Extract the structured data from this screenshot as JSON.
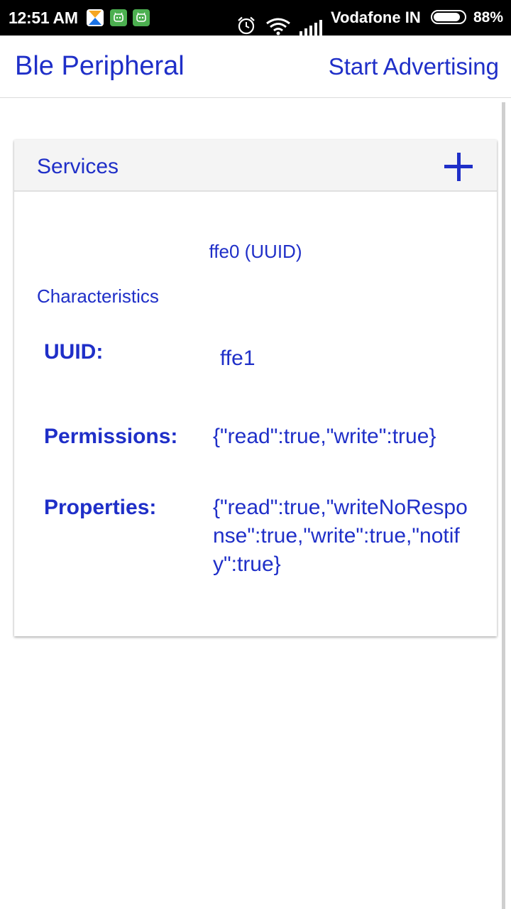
{
  "status_bar": {
    "time": "12:51 AM",
    "carrier": "Vodafone IN",
    "battery_percent": "88%",
    "battery_level": 0.88,
    "icons": [
      "notification-app-icon",
      "android-notification-icon",
      "android-notification-icon",
      "alarm-icon",
      "wifi-icon",
      "cell-signal-icon",
      "battery-icon"
    ]
  },
  "app_bar": {
    "title": "Ble Peripheral",
    "action_label": "Start Advertising"
  },
  "services_card": {
    "title": "Services",
    "add_icon": "plus-icon",
    "service_uuid": "ffe0 (UUID)",
    "characteristics_heading": "Characteristics",
    "characteristic": {
      "uuid_label": "UUID:",
      "uuid_value": "ffe1",
      "permissions_label": "Permissions:",
      "permissions_value": "{\"read\":true,\"write\":true}",
      "properties_label": "Properties:",
      "properties_value": "{\"read\":true,\"writeNoResponse\":true,\"write\":true,\"notify\":true}"
    }
  },
  "colors": {
    "accent": "#1f2fc8",
    "header_bg": "#f4f4f4",
    "status_bar_bg": "#000000"
  }
}
